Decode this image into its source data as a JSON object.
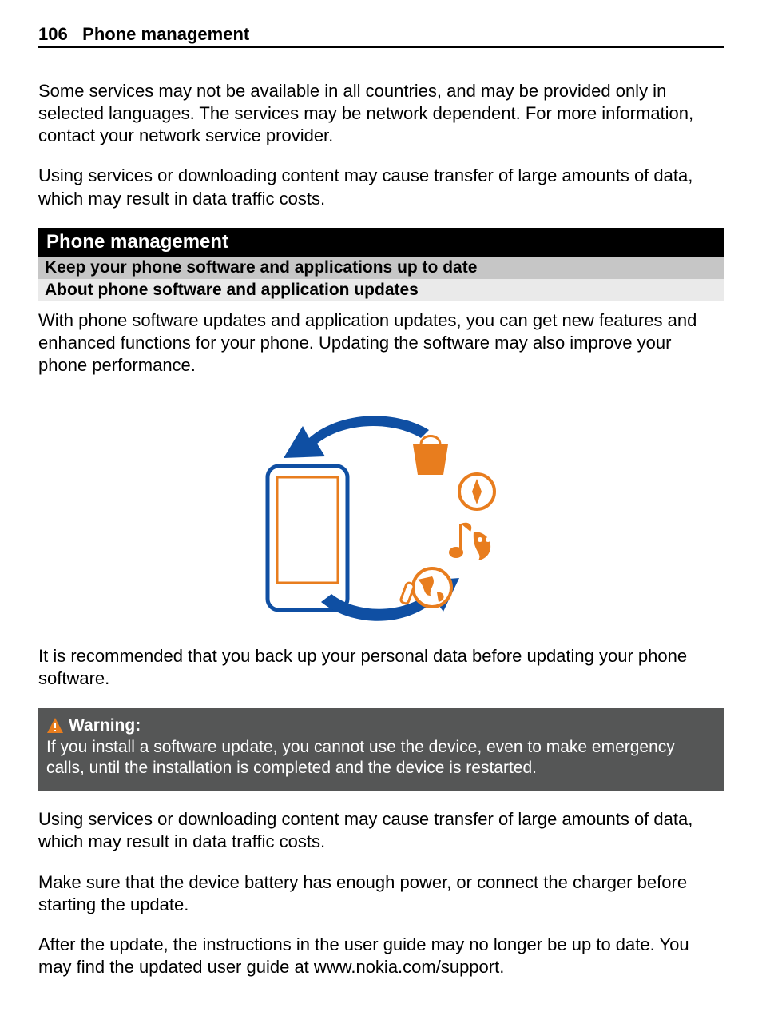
{
  "header": {
    "page_number": "106",
    "title": "Phone management"
  },
  "intro": {
    "p1": "Some services may not be available in all countries, and may be provided only in selected languages. The services may be network dependent. For more information, contact your network service provider.",
    "p2": "Using services or downloading content may cause transfer of large amounts of data, which may result in data traffic costs."
  },
  "section": {
    "black": "Phone management",
    "grey": "Keep your phone software and applications up to date",
    "lightgrey": "About phone software and application updates"
  },
  "body": {
    "p3": "With phone software updates and application updates, you can get new features and enhanced functions for your phone. Updating the software may also improve your phone performance.",
    "p4": "It is recommended that you back up your personal data before updating your phone software."
  },
  "warning": {
    "label": "Warning:",
    "text": "If you install a software update, you cannot use the device, even to make emergency calls, until the installation is completed and the device is restarted."
  },
  "after": {
    "p5": "Using services or downloading content may cause transfer of large amounts of data, which may result in data traffic costs.",
    "p6": "Make sure that the device battery has enough power, or connect the charger before starting the update.",
    "p7": "After the update, the instructions in the user guide may no longer be up to date. You may find the updated user guide at www.nokia.com/support."
  }
}
